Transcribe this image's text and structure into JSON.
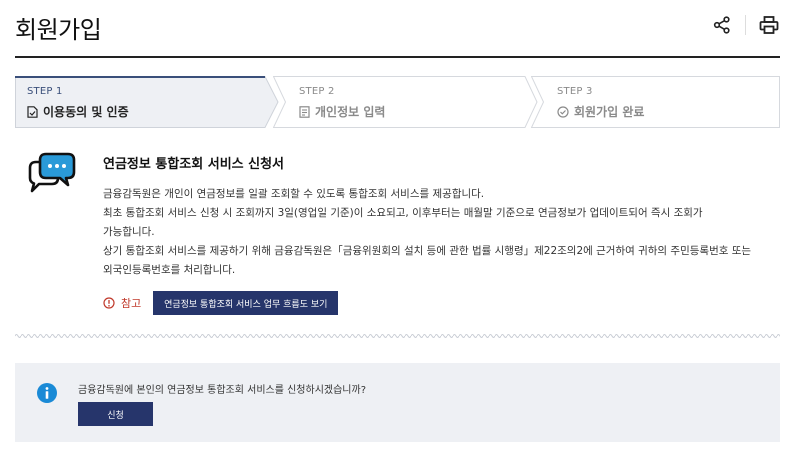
{
  "header": {
    "title": "회원가입",
    "share_icon": "share-icon",
    "print_icon": "print-icon"
  },
  "steps": [
    {
      "no": "STEP 1",
      "label": "이용동의 및 인증",
      "icon": "document-check-icon",
      "active": true
    },
    {
      "no": "STEP 2",
      "label": "개인정보 입력",
      "icon": "form-icon",
      "active": false
    },
    {
      "no": "STEP 3",
      "label": "회원가입 완료",
      "icon": "check-circle-icon",
      "active": false
    }
  ],
  "service": {
    "icon": "chat-bubbles-icon",
    "title": "연금정보 통합조회 서비스 신청서",
    "lines": [
      "금융감독원은 개인이 연금정보를 일괄 조회할 수 있도록 통합조회 서비스를 제공합니다.",
      "최초 통합조회 서비스 신청 시 조회까지 3일(영업일 기준)이 소요되고, 이후부터는 매월말 기준으로 연금정보가 업데이트되어 즉시 조회가",
      "가능합니다.",
      "상기 통합조회 서비스를 제공하기 위해 금융감독원은「금융위원회의 설치 등에 관한 법률 시행령」제22조의2에 근거하여 귀하의 주민등록번호 또는",
      "외국인등록번호를 처리합니다."
    ],
    "note_label": "참고",
    "flow_button": "연금정보 통합조회 서비스 업무 흐름도 보기"
  },
  "apply": {
    "icon": "info-icon",
    "question": "금융감독원에 본인의 연금정보 통합조회 서비스를 신청하시겠습니까?",
    "button": "신청"
  },
  "colors": {
    "navy": "#26356b",
    "info_blue": "#1a8ad6",
    "note_red": "#c0392b",
    "panel_bg": "#eef0f4"
  }
}
